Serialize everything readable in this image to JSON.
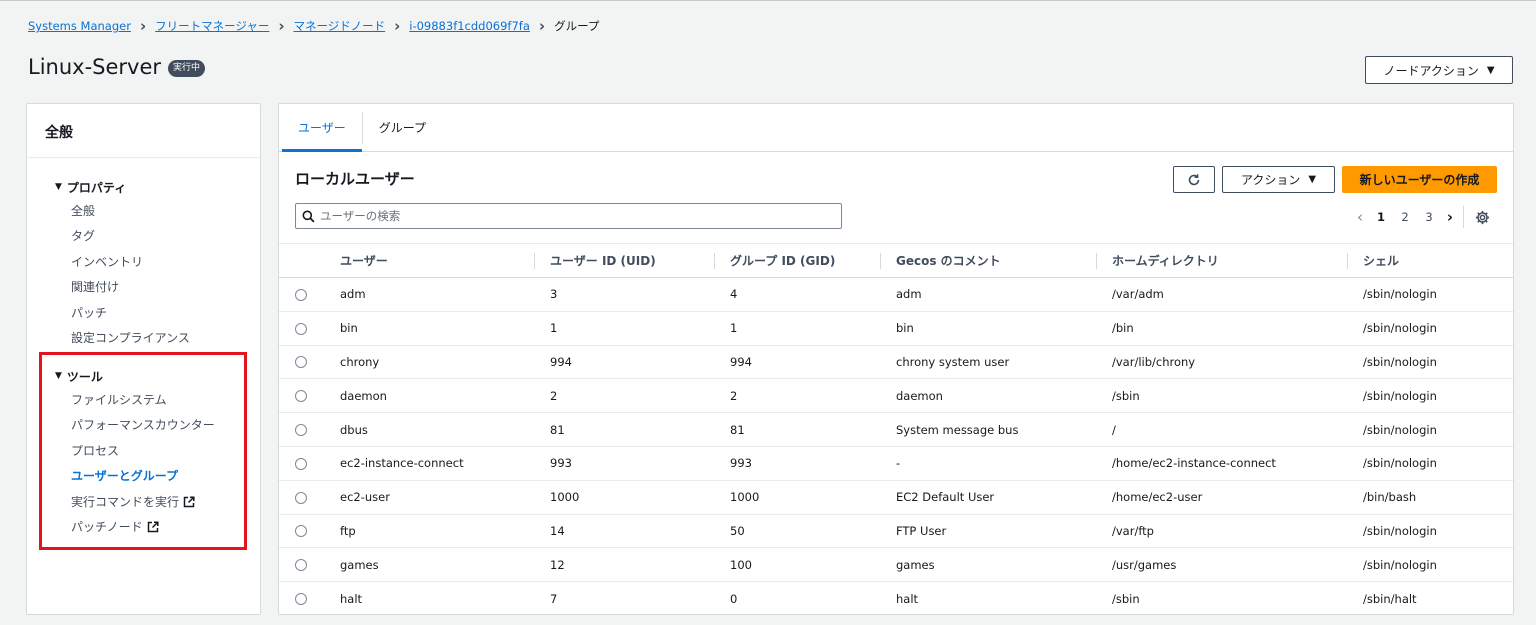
{
  "breadcrumb": {
    "items": [
      "Systems Manager",
      "フリートマネージャー",
      "マネージドノード",
      "i-09883f1cdd069f7fa"
    ],
    "current": "グループ"
  },
  "header": {
    "title": "Linux-Server",
    "status": "実行中",
    "node_action_label": "ノードアクション"
  },
  "sidebar": {
    "title": "全般",
    "properties": {
      "heading": "プロパティ",
      "items": [
        "全般",
        "タグ",
        "インベントリ",
        "関連付け",
        "パッチ",
        "設定コンプライアンス"
      ]
    },
    "tools": {
      "heading": "ツール",
      "items": [
        "ファイルシステム",
        "パフォーマンスカウンター",
        "プロセス",
        "ユーザーとグループ",
        "実行コマンドを実行",
        "パッチノード"
      ]
    }
  },
  "tabs": [
    "ユーザー",
    "グループ"
  ],
  "panel": {
    "title": "ローカルユーザー",
    "actions_label": "アクション",
    "create_label": "新しいユーザーの作成",
    "search_placeholder": "ユーザーの検索",
    "pages": [
      "1",
      "2",
      "3"
    ]
  },
  "table": {
    "columns": [
      "ユーザー",
      "ユーザー ID (UID)",
      "グループ ID (GID)",
      "Gecos のコメント",
      "ホームディレクトリ",
      "シェル"
    ],
    "rows": [
      [
        "adm",
        "3",
        "4",
        "adm",
        "/var/adm",
        "/sbin/nologin"
      ],
      [
        "bin",
        "1",
        "1",
        "bin",
        "/bin",
        "/sbin/nologin"
      ],
      [
        "chrony",
        "994",
        "994",
        "chrony system user",
        "/var/lib/chrony",
        "/sbin/nologin"
      ],
      [
        "daemon",
        "2",
        "2",
        "daemon",
        "/sbin",
        "/sbin/nologin"
      ],
      [
        "dbus",
        "81",
        "81",
        "System message bus",
        "/",
        "/sbin/nologin"
      ],
      [
        "ec2-instance-connect",
        "993",
        "993",
        "-",
        "/home/ec2-instance-connect",
        "/sbin/nologin"
      ],
      [
        "ec2-user",
        "1000",
        "1000",
        "EC2 Default User",
        "/home/ec2-user",
        "/bin/bash"
      ],
      [
        "ftp",
        "14",
        "50",
        "FTP User",
        "/var/ftp",
        "/sbin/nologin"
      ],
      [
        "games",
        "12",
        "100",
        "games",
        "/usr/games",
        "/sbin/nologin"
      ],
      [
        "halt",
        "7",
        "0",
        "halt",
        "/sbin",
        "/sbin/halt"
      ]
    ]
  },
  "colors": {
    "link": "#0972d3",
    "primary_button": "#ff9900",
    "highlight": "#e3141d",
    "badge": "#414d5c"
  }
}
